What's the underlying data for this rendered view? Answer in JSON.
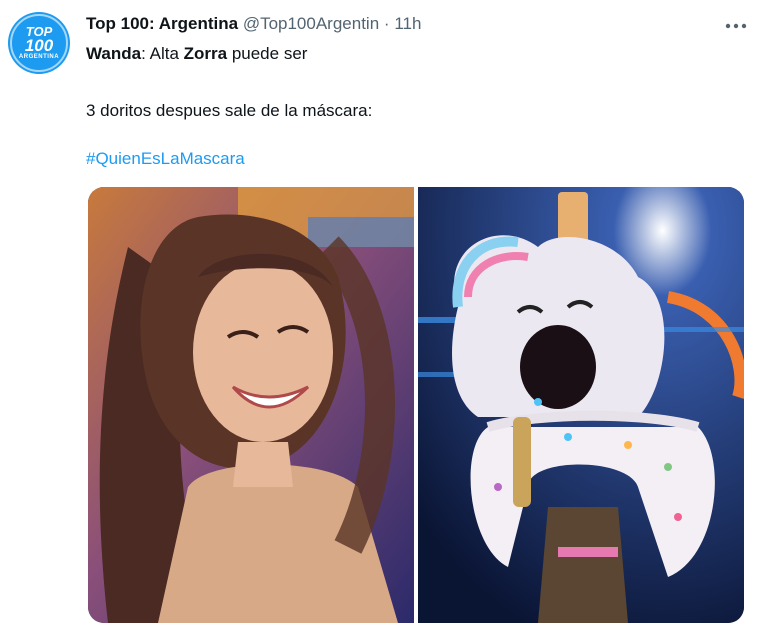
{
  "account": {
    "avatar_lines": [
      "TOP",
      "100",
      "ARGENTINA"
    ],
    "display_name": "Top 100: Argentina",
    "handle": "@Top100Argentin",
    "separator": "·",
    "time": "11h"
  },
  "more_menu_icon": "more-horizontal-icon",
  "tweet": {
    "line1_speaker": "Wanda",
    "line1_part1": ": Alta ",
    "line1_bold": "Zorra",
    "line1_part2": " puede ser",
    "line2": "3 doritos despues sale de la máscara:",
    "hashtag": "#QuienEsLaMascara"
  },
  "colors": {
    "accent": "#1d9bf0",
    "secondary_text": "#536471",
    "primary_text": "#0f1419"
  }
}
